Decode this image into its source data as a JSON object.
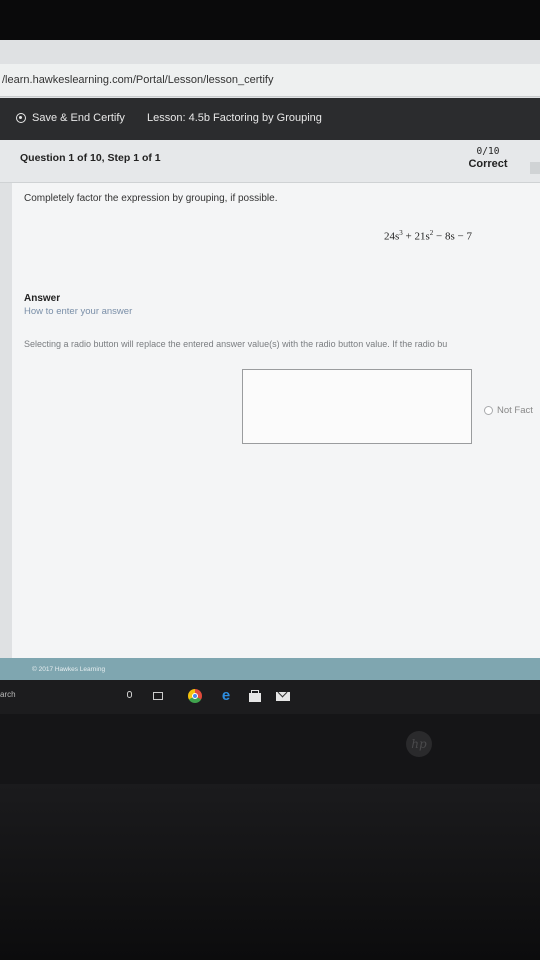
{
  "browser": {
    "url": "/learn.hawkeslearning.com/Portal/Lesson/lesson_certify"
  },
  "header": {
    "save_label": "Save & End Certify",
    "lesson_label": "Lesson: 4.5b Factoring by Grouping"
  },
  "question": {
    "title": "Question 1 of 10, Step 1 of 1",
    "score": "0/10",
    "status": "Correct",
    "instruction": "Completely factor the expression by grouping, if possible.",
    "expression": {
      "t1_coef": "24s",
      "t1_exp": "3",
      "op1": "+",
      "t2_coef": "21s",
      "t2_exp": "2",
      "op2": "−",
      "t3": "8s",
      "op3": "−",
      "t4": "7"
    }
  },
  "answer": {
    "heading": "Answer",
    "help_link": "How to enter your answer",
    "note": "Selecting a radio button will replace the entered answer value(s) with the radio button value. If the radio bu",
    "input_value": "",
    "radio_label": "Not Fact"
  },
  "footer": {
    "copyright": "© 2017 Hawkes Learning"
  },
  "taskbar": {
    "search_text": "arch"
  },
  "device": {
    "logo_text": "hp"
  },
  "colors": {
    "header_bg": "#2b2c2e",
    "footer_bg": "#7fa6b0",
    "help_link": "#7a8fa8"
  }
}
